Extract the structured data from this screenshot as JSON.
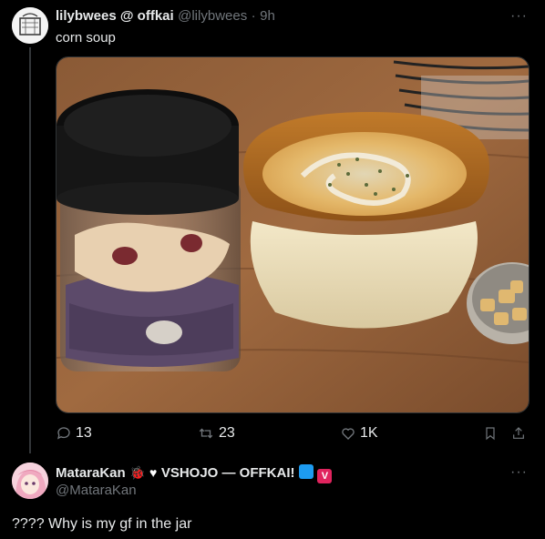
{
  "tweet": {
    "display_name": "lilybwees @ offkai",
    "handle": "@lilybwees",
    "separator": "·",
    "time": "9h",
    "text": "corn soup",
    "more": "···",
    "stats": {
      "replies": "13",
      "reposts": "23",
      "likes": "1K"
    }
  },
  "reply": {
    "display_name": "MataraKan",
    "display_name_suffix": "VSHOJO — OFFKAI!",
    "handle": "@MataraKan",
    "more": "···",
    "text": "???? Why is my gf in the jar",
    "badge_v": "V"
  },
  "colors": {
    "background": "#000000",
    "text": "#e7e9ea",
    "muted": "#71767b",
    "divider": "#2f3336",
    "accent_blue": "#1d9bf0",
    "accent_pink": "#e0245e"
  }
}
